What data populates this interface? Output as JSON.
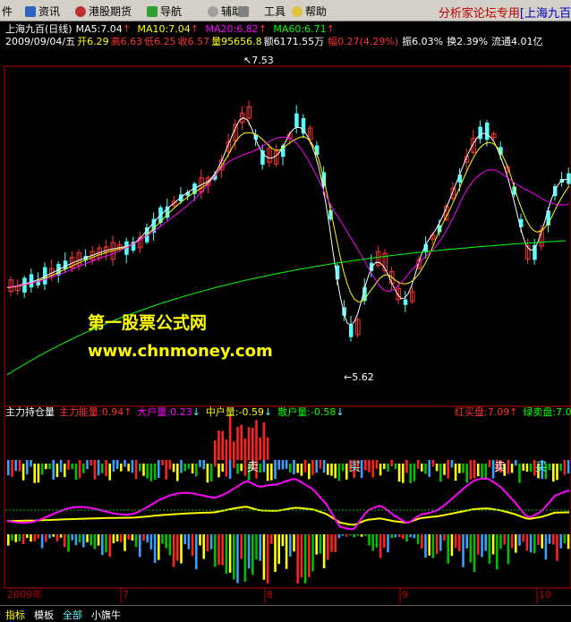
{
  "menu": {
    "items": [
      "件",
      "资讯",
      "港股期货",
      "导航",
      "辅助",
      "工具",
      "帮助"
    ],
    "brand_left": "分析家论坛专用",
    "brand_right": "[上海九百"
  },
  "header": {
    "name": "上海九百(日线)",
    "ma5": "MA5:7.04",
    "ma10": "MA10:7.04",
    "ma20": "MA20:6.82",
    "ma60": "MA60:6.71",
    "date": "2009/09/04/五",
    "open": "开6.29",
    "high": "高6.63",
    "low": "低6.25",
    "close": "收6.57",
    "volume": "量95656.8",
    "amount": "额6171.55万",
    "change": "幅0.27(4.29%)",
    "amplitude": "振6.03%",
    "turnover": "换2.39%",
    "float": "流通4.01亿"
  },
  "annotations": {
    "high_marker": "7.53",
    "low_marker": "5.62",
    "sell_labels": [
      "卖",
      "卖",
      "卖"
    ],
    "buy_labels": [
      "买",
      "买"
    ]
  },
  "watermark": {
    "line1": "第一股票公式网",
    "line2": "www.chnmoney.com"
  },
  "indicator": {
    "name": "主力持仓量",
    "main": "主力能量:0.94",
    "large": "大户量:0.23",
    "mid": "中户量:-0.59",
    "retail": "散户量:-0.58",
    "red_buy": "红买盘:7.09",
    "green_sell": "绿卖盘:7.0"
  },
  "xaxis": {
    "labels": [
      "2009年",
      "7",
      "8",
      "9",
      "10"
    ]
  },
  "tabs": [
    "指标",
    "模板",
    "全部",
    "小旗牛"
  ],
  "colors": {
    "up": "#ff3232",
    "down": "#54ffff",
    "ma5": "#ffffff",
    "ma10": "#ffff00",
    "ma20": "#ff00ff",
    "ma60": "#00ff00",
    "grid": "#c00000"
  }
}
